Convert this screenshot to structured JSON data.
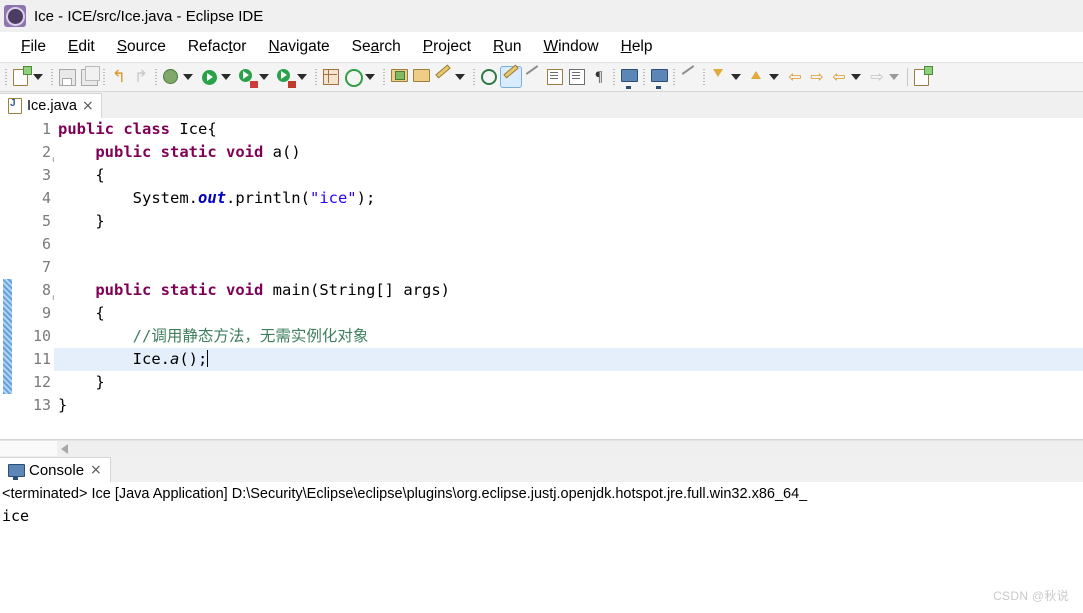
{
  "window": {
    "title": "Ice - ICE/src/Ice.java - Eclipse IDE",
    "icon": "eclipse-icon"
  },
  "menubar": {
    "items": [
      {
        "label": "File",
        "mnemonic": "F",
        "rest": "ile"
      },
      {
        "label": "Edit",
        "mnemonic": "E",
        "rest": "dit"
      },
      {
        "label": "Source",
        "mnemonic": "S",
        "rest": "ource"
      },
      {
        "label": "Refactor",
        "mnemonic": "t",
        "pre": "Refac",
        "rest": "or"
      },
      {
        "label": "Navigate",
        "mnemonic": "N",
        "rest": "avigate"
      },
      {
        "label": "Search",
        "mnemonic": "a",
        "pre": "Se",
        "rest": "rch"
      },
      {
        "label": "Project",
        "mnemonic": "P",
        "rest": "roject"
      },
      {
        "label": "Run",
        "mnemonic": "R",
        "rest": "un"
      },
      {
        "label": "Window",
        "mnemonic": "W",
        "rest": "indow"
      },
      {
        "label": "Help",
        "mnemonic": "H",
        "rest": "elp"
      }
    ]
  },
  "toolbar": {
    "buttons": [
      "new-wizard-icon",
      "new-wizard-dropdown",
      "save-icon",
      "save-all-icon",
      "undo-icon",
      "redo-icon",
      "debug-icon",
      "debug-dropdown",
      "run-icon",
      "run-dropdown",
      "coverage-icon",
      "coverage-dropdown",
      "profile-icon",
      "profile-dropdown",
      "new-java-project-icon",
      "new-annotation-icon",
      "new-annotation-dropdown",
      "open-type-icon",
      "open-task-icon",
      "search-icon",
      "search-dropdown",
      "next-annotation-icon",
      "toggle-mark-occurrences-icon",
      "skip-breakpoints-icon",
      "open-declaration-icon",
      "show-whitespace-icon",
      "paragraph-icon",
      "console-icon",
      "terminal-icon",
      "pin-icon",
      "previous-edit-icon",
      "prev-dropdown",
      "next-edit-icon",
      "next-dropdown",
      "back-with-mark-icon",
      "forward-with-mark-icon",
      "back-icon",
      "back-dropdown",
      "forward-icon",
      "forward-dropdown",
      "new-window-icon"
    ]
  },
  "editor": {
    "tab": {
      "filename": "Ice.java",
      "close": "×",
      "file_icon": "java-file-icon"
    },
    "change_bar": {
      "from_line": 8,
      "to_line": 12
    },
    "current_line": 11,
    "fold_lines": [
      2,
      8
    ],
    "lines": [
      {
        "n": "1",
        "segments": [
          {
            "t": "public",
            "c": "kw"
          },
          {
            "t": " ",
            "c": ""
          },
          {
            "t": "class",
            "c": "kw"
          },
          {
            "t": " Ice{",
            "c": ""
          }
        ]
      },
      {
        "n": "2",
        "segments": [
          {
            "t": "    ",
            "c": ""
          },
          {
            "t": "public",
            "c": "kw"
          },
          {
            "t": " ",
            "c": ""
          },
          {
            "t": "static",
            "c": "kw"
          },
          {
            "t": " ",
            "c": ""
          },
          {
            "t": "void",
            "c": "kw"
          },
          {
            "t": " a()",
            "c": ""
          }
        ]
      },
      {
        "n": "3",
        "segments": [
          {
            "t": "    {",
            "c": ""
          }
        ]
      },
      {
        "n": "4",
        "segments": [
          {
            "t": "        System.",
            "c": ""
          },
          {
            "t": "out",
            "c": "fld"
          },
          {
            "t": ".println(",
            "c": ""
          },
          {
            "t": "\"ice\"",
            "c": "str"
          },
          {
            "t": ");",
            "c": ""
          }
        ]
      },
      {
        "n": "5",
        "segments": [
          {
            "t": "    }",
            "c": ""
          }
        ]
      },
      {
        "n": "6",
        "segments": [
          {
            "t": "",
            "c": ""
          }
        ]
      },
      {
        "n": "7",
        "segments": [
          {
            "t": "",
            "c": ""
          }
        ]
      },
      {
        "n": "8",
        "segments": [
          {
            "t": "    ",
            "c": ""
          },
          {
            "t": "public",
            "c": "kw"
          },
          {
            "t": " ",
            "c": ""
          },
          {
            "t": "static",
            "c": "kw"
          },
          {
            "t": " ",
            "c": ""
          },
          {
            "t": "void",
            "c": "kw"
          },
          {
            "t": " main(String[] args)",
            "c": ""
          }
        ]
      },
      {
        "n": "9",
        "segments": [
          {
            "t": "    {",
            "c": ""
          }
        ]
      },
      {
        "n": "10",
        "segments": [
          {
            "t": "        ",
            "c": ""
          },
          {
            "t": "//调用静态方法，无需实例化对象",
            "c": "cmt"
          }
        ]
      },
      {
        "n": "11",
        "segments": [
          {
            "t": "        Ice.",
            "c": ""
          },
          {
            "t": "a",
            "c": "mth"
          },
          {
            "t": "();",
            "c": ""
          }
        ],
        "caret": true
      },
      {
        "n": "12",
        "segments": [
          {
            "t": "    }",
            "c": ""
          }
        ]
      },
      {
        "n": "13",
        "segments": [
          {
            "t": "}",
            "c": ""
          }
        ]
      }
    ]
  },
  "console": {
    "tab": {
      "label": "Console",
      "close": "×",
      "icon": "console-monitor-icon"
    },
    "terminated_line": "<terminated> Ice [Java Application] D:\\Security\\Eclipse\\eclipse\\plugins\\org.eclipse.justj.openjdk.hotspot.jre.full.win32.x86_64_",
    "output": [
      "ice"
    ]
  },
  "watermark": "CSDN @秋说",
  "colors": {
    "keyword": "#7f0055",
    "field": "#0000c0",
    "string": "#2a00ff",
    "comment": "#3f7f5f",
    "current_line": "#e4effb",
    "change_bar": "#4a90d9",
    "titlebar": "#f0f0f0"
  }
}
